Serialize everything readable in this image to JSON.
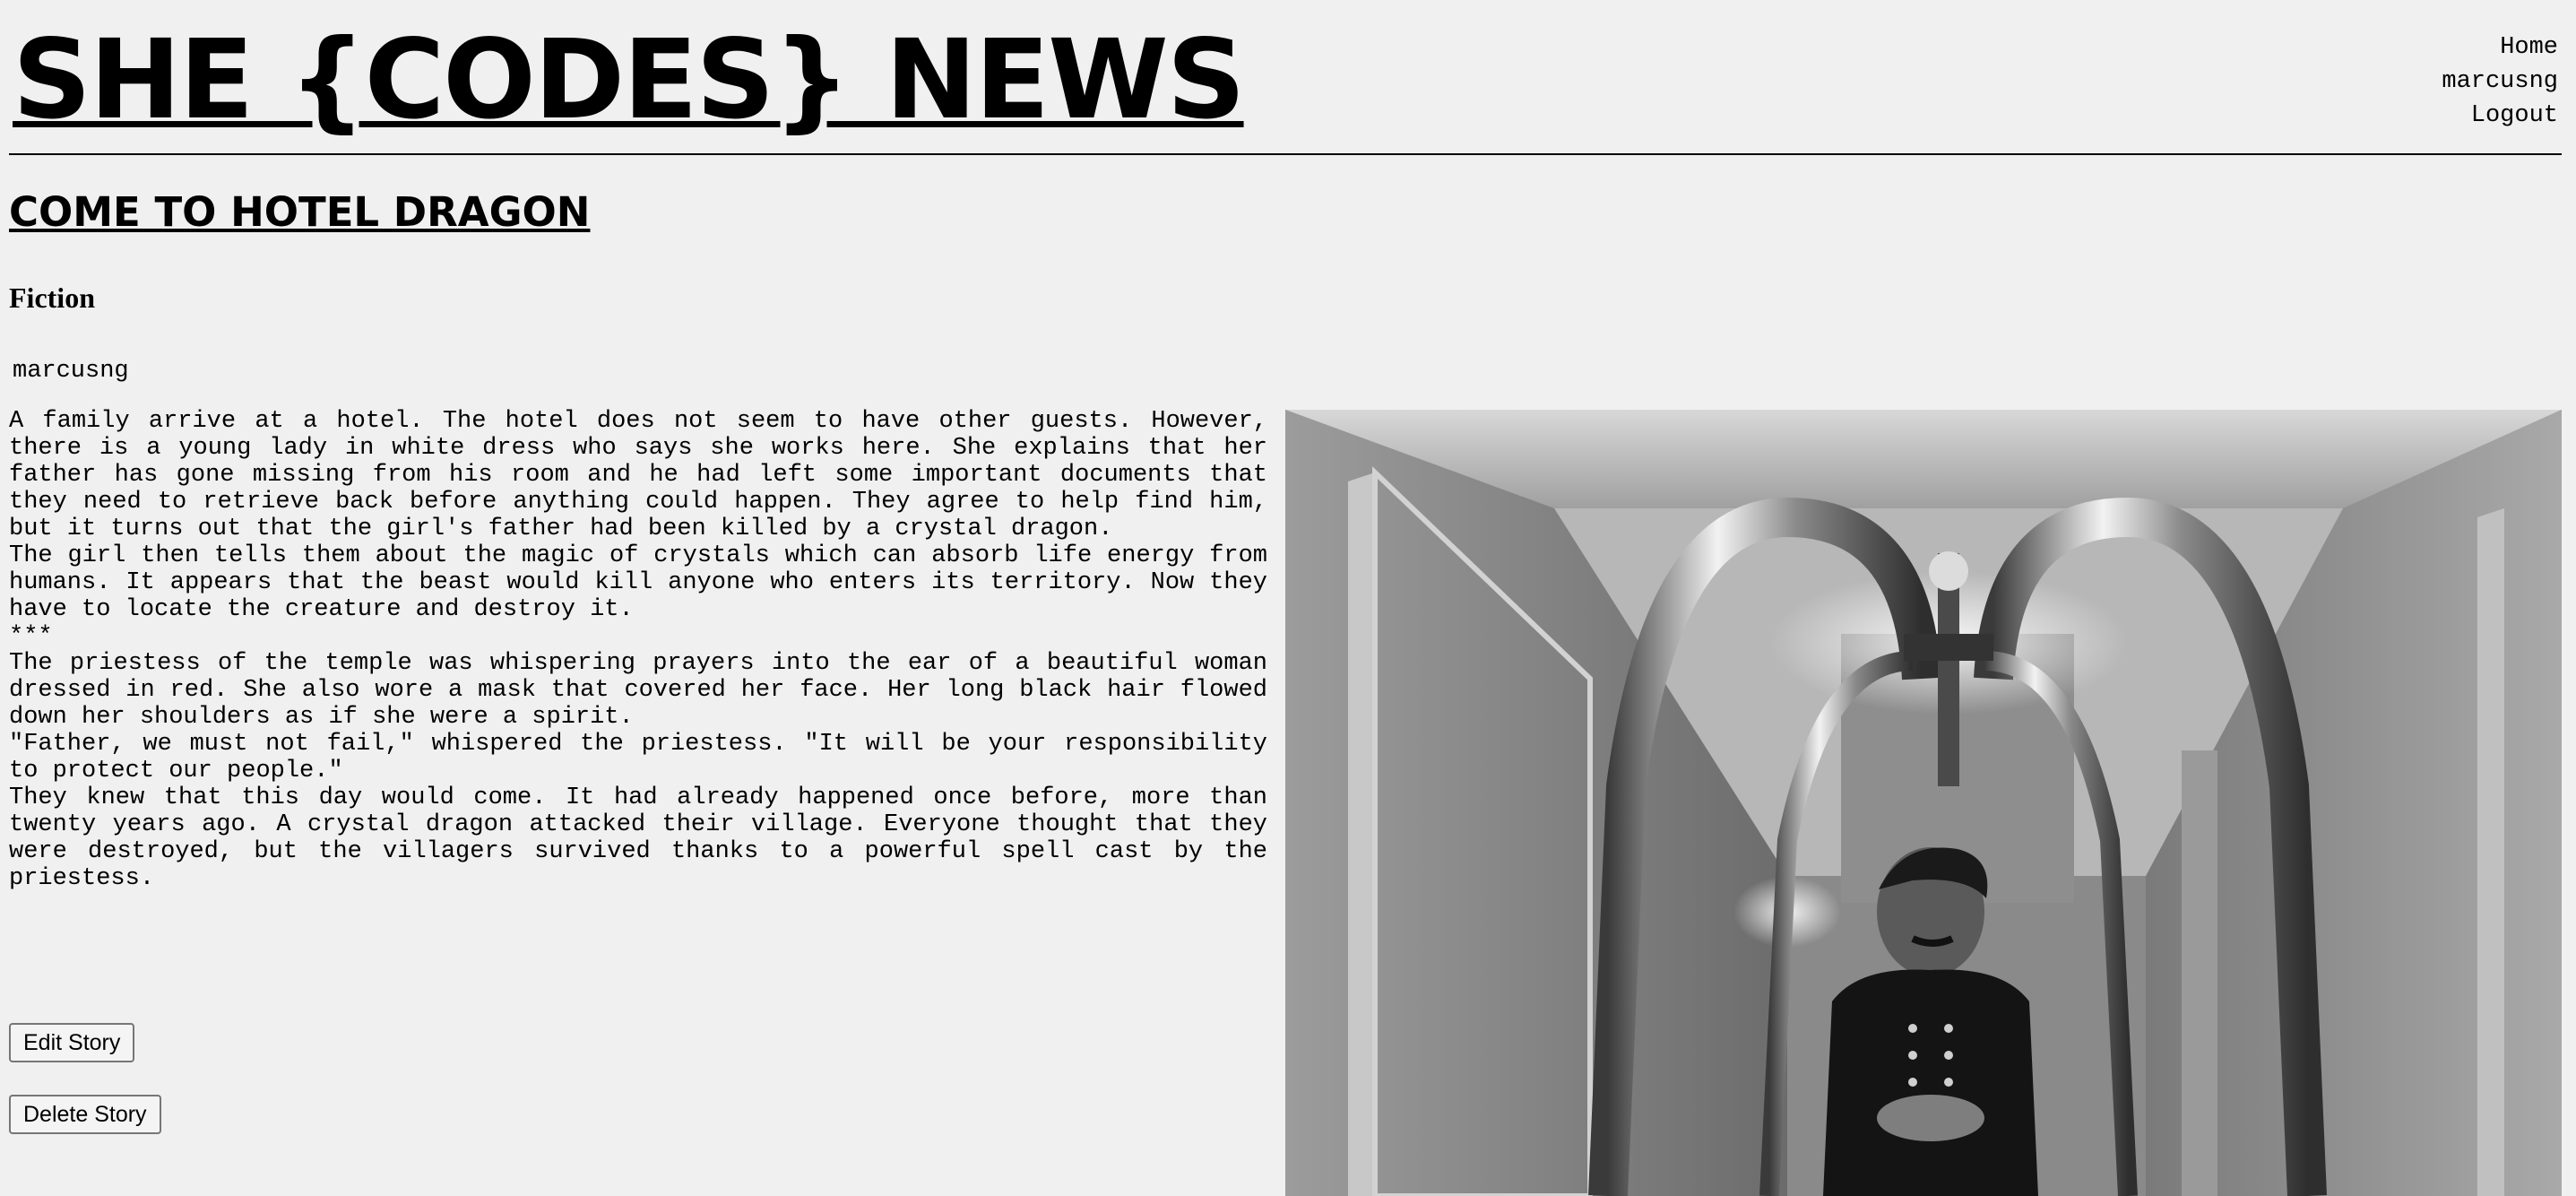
{
  "header": {
    "site_title": "SHE {CODES} NEWS",
    "nav": {
      "home": "Home",
      "user": "marcusng",
      "logout": "Logout"
    }
  },
  "story": {
    "title": "COME TO HOTEL DRAGON",
    "category": "Fiction",
    "author": "marcusng",
    "paragraphs": [
      "A family arrive at a hotel. The hotel does not seem to have other guests. However, there is a young lady in white dress who says she works here. She explains that her father has gone missing from his room and he had left some important documents that they need to retrieve back before anything could happen. They agree to help find him, but it turns out that the girl's father had been killed by a crystal dragon.",
      "The girl then tells them about the magic of crystals which can absorb life energy from humans. It appears that the beast would kill anyone who enters its territory. Now they have to locate the creature and destroy it.",
      "***",
      "The priestess of the temple was whispering prayers into the ear of a beautiful woman dressed in red. She also wore a mask that covered her face. Her long black hair flowed down her shoulders as if she were a spirit.",
      "\"Father, we must not fail,\" whispered the priestess. \"It will be your responsibility to protect our people.\"",
      "They knew that this day would come. It had already happened once before, more than twenty years ago. A crystal dragon attacked their village. Everyone thought that they were destroyed, but the villagers survived thanks to a powerful spell cast by the priestess."
    ]
  },
  "actions": {
    "edit_label": "Edit Story",
    "delete_label": "Delete Story"
  },
  "image": {
    "icon": "story-photo",
    "tone": "black-and-white"
  }
}
